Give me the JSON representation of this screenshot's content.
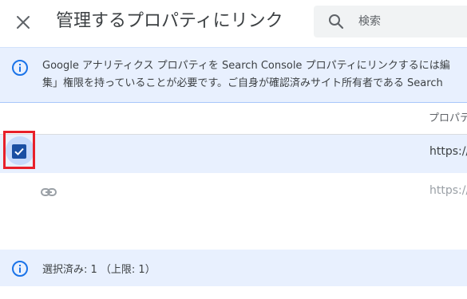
{
  "header": {
    "title": "管理するプロパティにリンク",
    "close_icon": "close-icon",
    "search": {
      "placeholder": "検索",
      "value": "",
      "icon": "search-icon"
    }
  },
  "info_banner": {
    "icon": "info-icon",
    "line1": "Google アナリティクス プロパティを Search Console プロパティにリンクするには編",
    "line2": "集」権限を持っていることが必要です。ご自身が確認済みサイト所有者である Search"
  },
  "table": {
    "column_header": "プロパテ",
    "rows": [
      {
        "selected": true,
        "checkbox_checked": true,
        "url": "https://"
      },
      {
        "selected": false,
        "icon": "link-icon",
        "url": "https://"
      }
    ]
  },
  "status": {
    "icon": "info-icon",
    "text": "選択済み: 1 （上限: 1）"
  },
  "colors": {
    "accent": "#1a73e8",
    "checkbox": "#1a4fa3",
    "selected_row": "#e8f0fe",
    "highlight_box": "#e8202a"
  }
}
